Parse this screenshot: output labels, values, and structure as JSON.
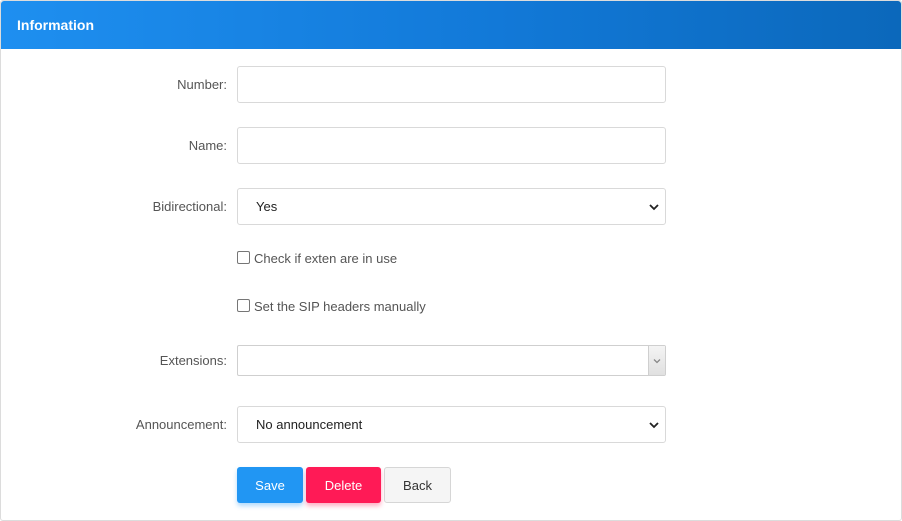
{
  "header": {
    "title": "Information"
  },
  "form": {
    "number": {
      "label": "Number:",
      "value": ""
    },
    "name": {
      "label": "Name:",
      "value": ""
    },
    "bidirectional": {
      "label": "Bidirectional:",
      "value": "Yes"
    },
    "check_exten": {
      "label": "Check if exten are in use",
      "checked": false
    },
    "sip_headers": {
      "label": "Set the SIP headers manually",
      "checked": false
    },
    "extensions": {
      "label": "Extensions:",
      "value": ""
    },
    "announcement": {
      "label": "Announcement:",
      "value": "No announcement"
    }
  },
  "buttons": {
    "save": "Save",
    "delete": "Delete",
    "back": "Back"
  },
  "colors": {
    "header": "#1a86e6",
    "save": "#2196f3",
    "delete": "#ff1a56",
    "back": "#f5f5f5"
  }
}
